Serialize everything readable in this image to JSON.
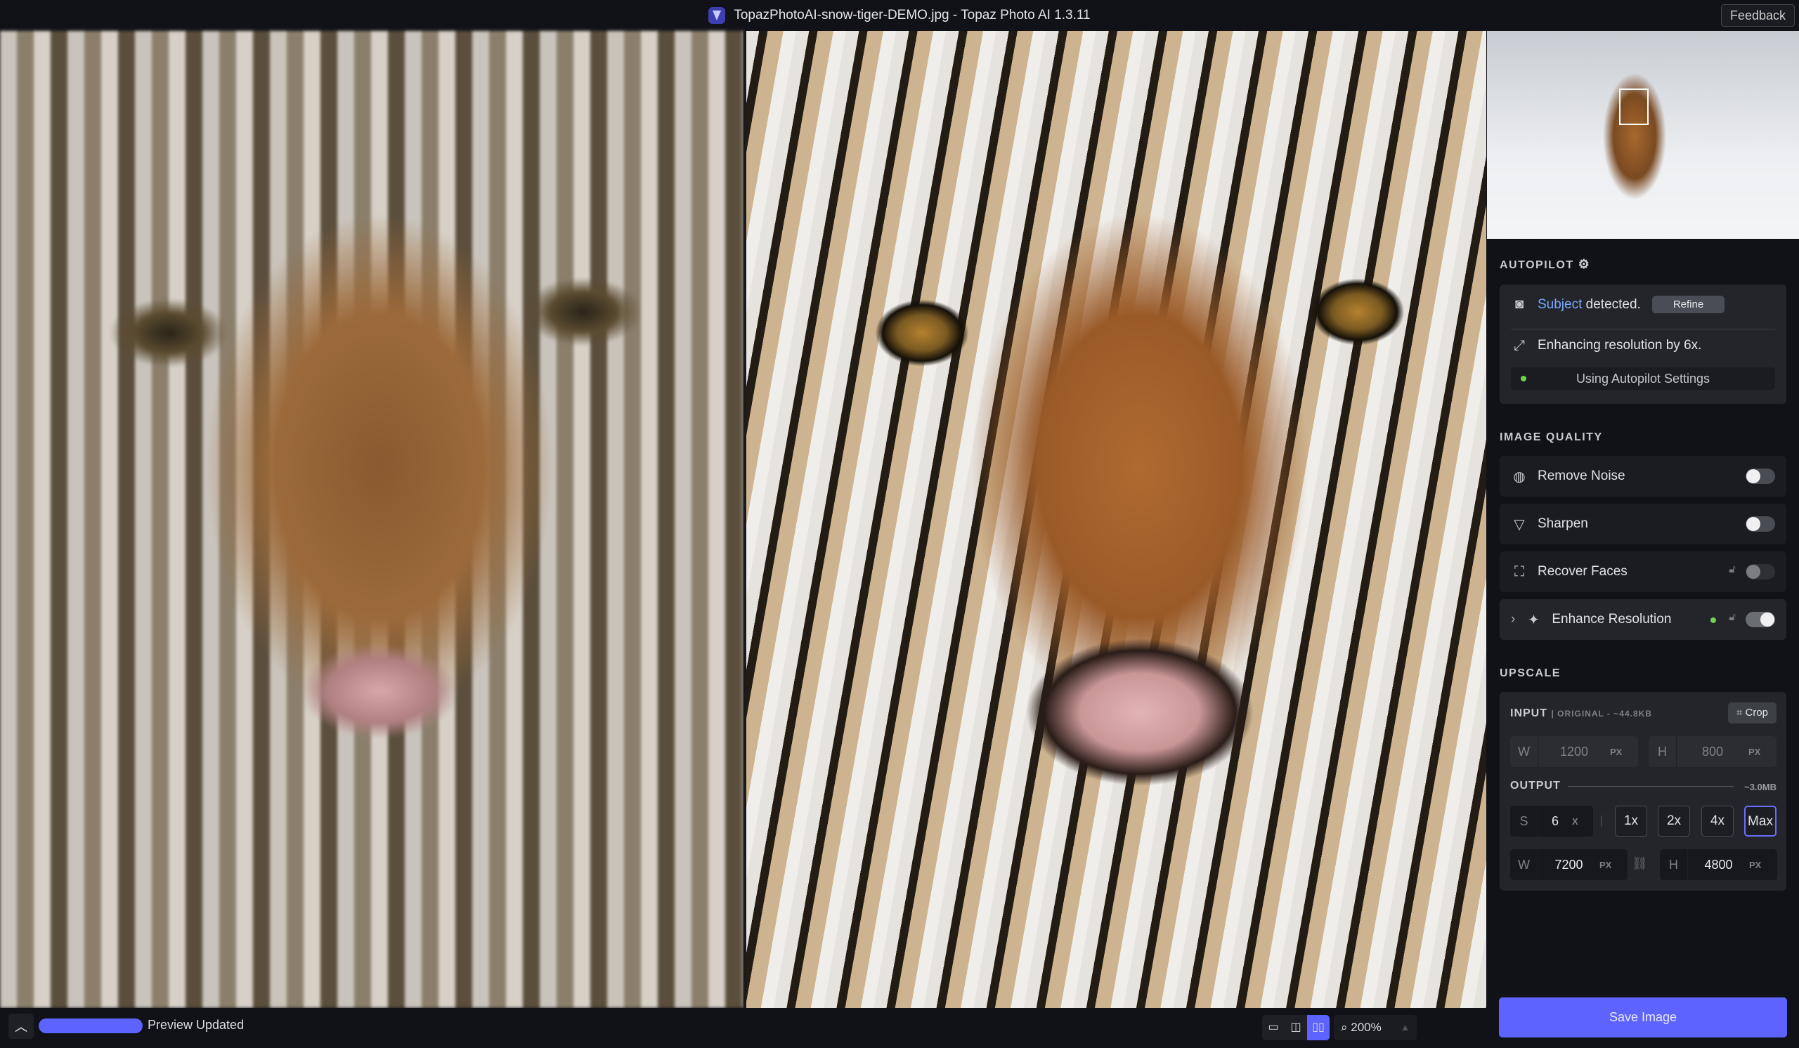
{
  "titlebar": {
    "title": "TopazPhotoAI-snow-tiger-DEMO.jpg - Topaz Photo AI 1.3.11",
    "feedback": "Feedback"
  },
  "autopilot": {
    "heading": "AUTOPILOT",
    "subject": "Subject",
    "detected": "detected.",
    "refine": "Refine",
    "enhancing": "Enhancing resolution by 6x.",
    "status": "Using Autopilot Settings"
  },
  "image_quality": {
    "heading": "IMAGE QUALITY",
    "items": [
      {
        "label": "Remove Noise",
        "enabled": false,
        "locked": false
      },
      {
        "label": "Sharpen",
        "enabled": false,
        "locked": false
      },
      {
        "label": "Recover Faces",
        "enabled": false,
        "locked": true
      },
      {
        "label": "Enhance Resolution",
        "enabled": true,
        "locked": true
      }
    ]
  },
  "upscale": {
    "heading": "UPSCALE",
    "input_label": "INPUT",
    "input_meta": "| ORIGINAL - ~44.8KB",
    "crop": "Crop",
    "input_w": {
      "label": "W",
      "value": "1200",
      "unit": "PX"
    },
    "input_h": {
      "label": "H",
      "value": "800",
      "unit": "PX"
    },
    "output_label": "OUTPUT",
    "output_size": "~3.0MB",
    "scale": {
      "label": "S",
      "value": "6",
      "unit": "X"
    },
    "presets": [
      "1x",
      "2x",
      "4x",
      "Max"
    ],
    "selected_preset": "Max",
    "output_w": {
      "label": "W",
      "value": "7200",
      "unit": "PX"
    },
    "output_h": {
      "label": "H",
      "value": "4800",
      "unit": "PX"
    }
  },
  "save": "Save Image",
  "bottom": {
    "status": "Preview Updated",
    "progress": 1.0,
    "zoom": "200%"
  },
  "colors": {
    "accent": "#5c63ff",
    "status_green": "#6fd34a",
    "subject_link": "#7aa8ff"
  }
}
